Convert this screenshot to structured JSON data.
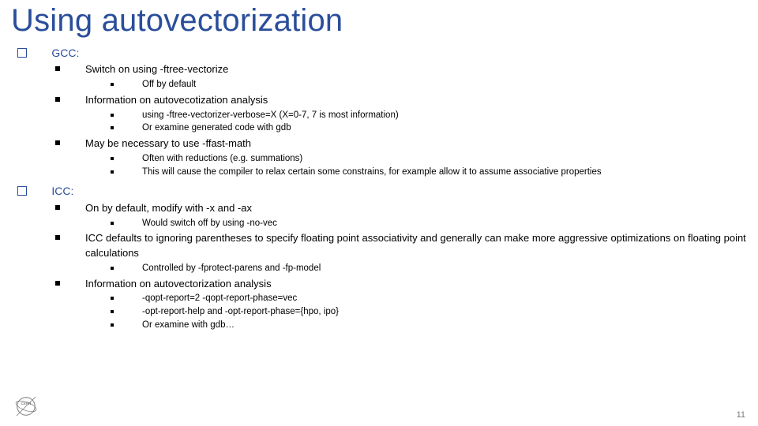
{
  "title": "Using autovectorization",
  "sections": [
    {
      "label": "GCC:",
      "items": [
        {
          "text": "Switch on using -ftree-vectorize",
          "sub": [
            "Off by default"
          ]
        },
        {
          "text": "Information on autovecotization analysis",
          "sub": [
            "using -ftree-vectorizer-verbose=X (X=0-7, 7 is most information)",
            "Or examine generated code with gdb"
          ]
        },
        {
          "text": "May be necessary to use -ffast-math",
          "sub": [
            "Often with reductions (e.g. summations)",
            "This will cause the compiler to relax certain some constrains, for example allow it to assume associative properties"
          ]
        }
      ]
    },
    {
      "label": "ICC:",
      "items": [
        {
          "text": "On by default, modify with -x and -ax",
          "sub": [
            "Would switch off by using -no-vec"
          ]
        },
        {
          "text": "ICC defaults to ignoring parentheses to specify floating point associativity and generally can make more aggressive optimizations on floating point calculations",
          "sub": [
            "Controlled by -fprotect-parens and -fp-model"
          ]
        },
        {
          "text": "Information on autovectorization analysis",
          "sub": [
            "-qopt-report=2 -qopt-report-phase=vec",
            "-opt-report-help and -opt-report-phase={hpo, ipo}",
            "Or examine with gdb…"
          ]
        }
      ]
    }
  ],
  "page_number": "11",
  "logo_label": "CERN"
}
